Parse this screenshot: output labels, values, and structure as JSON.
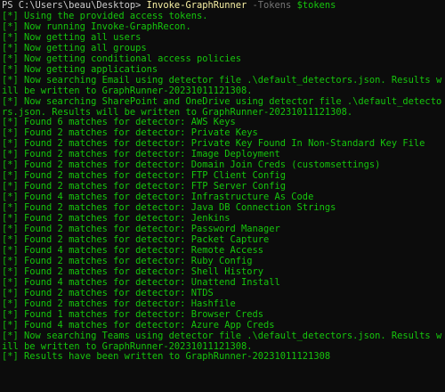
{
  "terminal": {
    "prompt": "PS C:\\Users\\beau\\Desktop> ",
    "command": "Invoke-GraphRunner",
    "param": " -Tokens ",
    "variable": "$tokens",
    "colors": {
      "background": "#0c0c0c",
      "text": "#cccccc",
      "output": "#16c60c",
      "command": "#f9f1a5",
      "parameter": "#767676",
      "variable": "#16c60c"
    },
    "lines": [
      "[*] Using the provided access tokens.",
      "[*] Now running Invoke-GraphRecon.",
      "[*] Now getting all users",
      "[*] Now getting all groups",
      "[*] Now getting conditional access policies",
      "[*] Now getting applications",
      "[*] Now searching Email using detector file .\\default_detectors.json. Results will be written to GraphRunner-20231011121308.",
      "[*] Now searching SharePoint and OneDrive using detector file .\\default_detectors.json. Results will be written to GraphRunner-20231011121308.",
      "[*] Found 6 matches for detector: AWS Keys",
      "[*] Found 2 matches for detector: Private Keys",
      "[*] Found 2 matches for detector: Private Key Found In Non-Standard Key File",
      "[*] Found 2 matches for detector: Image Deployment",
      "[*] Found 2 matches for detector: Domain Join Creds (customsettings)",
      "[*] Found 2 matches for detector: FTP Client Config",
      "[*] Found 2 matches for detector: FTP Server Config",
      "[*] Found 4 matches for detector: Infrastructure As Code",
      "[*] Found 2 matches for detector: Java DB Connection Strings",
      "[*] Found 2 matches for detector: Jenkins",
      "[*] Found 2 matches for detector: Password Manager",
      "[*] Found 2 matches for detector: Packet Capture",
      "[*] Found 4 matches for detector: Remote Access",
      "[*] Found 2 matches for detector: Ruby Config",
      "[*] Found 2 matches for detector: Shell History",
      "[*] Found 4 matches for detector: Unattend Install",
      "[*] Found 2 matches for detector: NTDS",
      "[*] Found 2 matches for detector: Hashfile",
      "[*] Found 1 matches for detector: Browser Creds",
      "[*] Found 4 matches for detector: Azure App Creds",
      "[*] Now searching Teams using detector file .\\default_detectors.json. Results will be written to GraphRunner-20231011121308.",
      "[*] Results have been written to GraphRunner-20231011121308"
    ]
  }
}
